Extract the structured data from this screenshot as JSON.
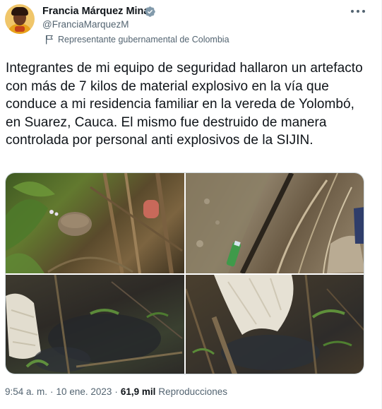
{
  "author": {
    "display_name": "Francia Márquez Mina",
    "handle": "@FranciaMarquezM",
    "label": "Representante gubernamental de Colombia",
    "verified_color": "#829aab"
  },
  "icons": {
    "more": "more-options-icon",
    "verified": "verified-badge-icon",
    "label": "flag-icon"
  },
  "tweet": {
    "text": "Integrantes de mi equipo de seguridad hallaron un artefacto con más de 7 kilos de material explosivo en la vía que conduce a mi residencia familiar en la vereda de Yolombó, en Suarez, Cauca. El mismo fue destruido de manera controlada por personal anti explosivos de la SIJIN."
  },
  "meta": {
    "time": "9:54 a. m.",
    "separator": "·",
    "date": "10 ene. 2023",
    "views_count": "61,9 mil",
    "views_label": "Reproducciones"
  },
  "colors": {
    "text_primary": "#0f1419",
    "text_secondary": "#536471",
    "border": "#cfd9de"
  }
}
